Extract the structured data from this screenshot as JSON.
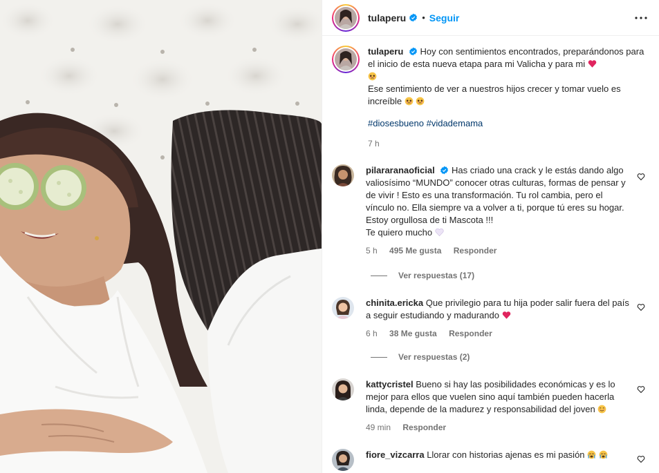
{
  "post": {
    "username": "tulaperu",
    "follow_label": "Seguir",
    "separator": "•"
  },
  "caption": {
    "username": "tulaperu",
    "line1": "Hoy con sentimientos encontrados, preparándonos para el inicio de esta nueva etapa para mi Valicha y para mi",
    "line2": "Ese sentimiento de ver a nuestros hijos crecer y tomar vuelo es increíble",
    "hashtag1": "#diosesbueno",
    "hashtag2": "#vidademama",
    "time": "7 h"
  },
  "comments": [
    {
      "username": "pilararanaoficial",
      "text": "Has criado una crack y le estás dando algo valiosísimo “MUNDO” conocer otras culturas, formas de pensar y de vivir ! Esto es una transformación. Tu rol cambia, pero el vínculo no. Ella siempre va a volver a ti, porque tú eres su hogar. Estoy orgullosa de ti Mascota !!!",
      "text2": "Te quiero mucho",
      "time": "5 h",
      "likes": "495 Me gusta",
      "reply": "Responder",
      "view_replies": "Ver respuestas (17)"
    },
    {
      "username": "chinita.ericka",
      "text": "Que privilegio para tu hija poder salir fuera del país a seguir estudiando y madurando",
      "time": "6 h",
      "likes": "38 Me gusta",
      "reply": "Responder",
      "view_replies": "Ver respuestas (2)"
    },
    {
      "username": "kattycristel",
      "text": "Bueno si hay las posibilidades económicas y es lo mejor para ellos que vuelen sino aquí también pueden hacerla linda, depende de la madurez y responsabilidad del joven",
      "time": "49 min",
      "reply": "Responder"
    },
    {
      "username": "fiore_vizcarra",
      "text": "Llorar con historias ajenas es mi pasión"
    }
  ],
  "icons": {
    "verified": "verified-badge-icon",
    "more": "more-options-icon",
    "like": "heart-outline-icon"
  },
  "colors": {
    "link": "#0095f6",
    "hashtag": "#00376b",
    "muted": "#737373",
    "heart": "#e0245e"
  }
}
